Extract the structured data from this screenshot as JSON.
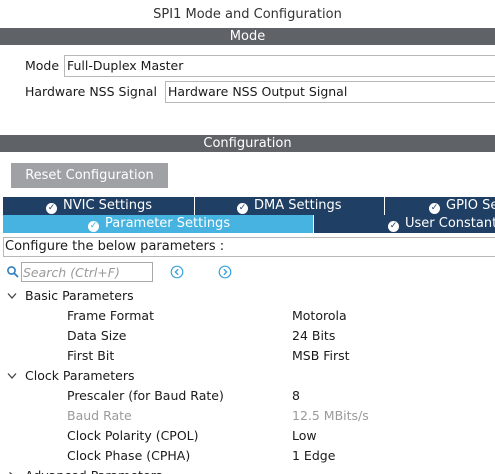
{
  "window": {
    "title": "SPI1 Mode and Configuration"
  },
  "mode_section": {
    "header": "Mode",
    "mode_label": "Mode",
    "mode_value": "Full-Duplex Master",
    "nss_label": "Hardware NSS Signal",
    "nss_value": "Hardware NSS Output Signal"
  },
  "config_section": {
    "header": "Configuration",
    "reset_label": "Reset Configuration",
    "tabs_row1": [
      {
        "label": "NVIC Settings",
        "icon": "check-circle-icon"
      },
      {
        "label": "DMA Settings",
        "icon": "check-circle-icon"
      },
      {
        "label": "GPIO Settings",
        "icon": "check-circle-icon"
      }
    ],
    "tabs_row2": [
      {
        "label": "Parameter Settings",
        "icon": "check-circle-icon",
        "active": true
      },
      {
        "label": "User Constants",
        "icon": "check-circle-icon"
      }
    ],
    "description": "Configure the below parameters :",
    "search_placeholder": "Search (Ctrl+F)"
  },
  "groups": [
    {
      "label": "Basic Parameters",
      "expanded": true,
      "params": [
        {
          "name": "Frame Format",
          "value": "Motorola",
          "enabled": true
        },
        {
          "name": "Data Size",
          "value": "24 Bits",
          "enabled": true
        },
        {
          "name": "First Bit",
          "value": "MSB First",
          "enabled": true
        }
      ]
    },
    {
      "label": "Clock Parameters",
      "expanded": true,
      "params": [
        {
          "name": "Prescaler (for Baud Rate)",
          "value": "8",
          "enabled": true
        },
        {
          "name": "Baud Rate",
          "value": "12.5 MBits/s",
          "enabled": false
        },
        {
          "name": "Clock Polarity (CPOL)",
          "value": "Low",
          "enabled": true
        },
        {
          "name": "Clock Phase (CPHA)",
          "value": "1 Edge",
          "enabled": true
        }
      ]
    },
    {
      "label": "Advanced Parameters",
      "expanded": false,
      "params": []
    }
  ],
  "colors": {
    "section_bar": "#5f6368",
    "tab_bg": "#1f3f64",
    "tab_active": "#47b3e0",
    "nav_icon": "#3ea3dc"
  }
}
